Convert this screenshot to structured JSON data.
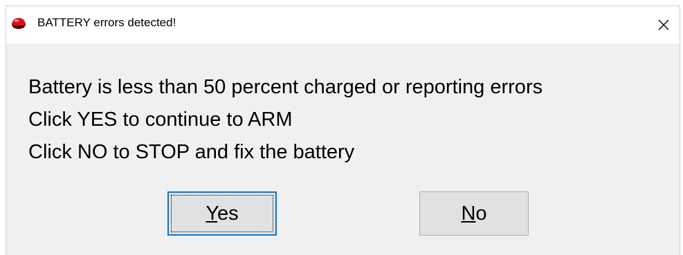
{
  "window": {
    "title": "BATTERY errors detected!",
    "icon": "app-icon-red",
    "close_glyph": "close-icon"
  },
  "message": {
    "lines": [
      "Battery is less than 50 percent charged or reporting errors",
      "Click YES to continue to ARM",
      "Click NO to STOP and fix the battery"
    ]
  },
  "buttons": {
    "yes": {
      "mnemonic": "Y",
      "rest": "es"
    },
    "no": {
      "mnemonic": "N",
      "rest": "o"
    }
  },
  "colors": {
    "focus_border": "#0078d7",
    "button_face": "#e1e1e1",
    "dialog_bg": "#f0f0f0",
    "icon_red": "#e01010"
  }
}
